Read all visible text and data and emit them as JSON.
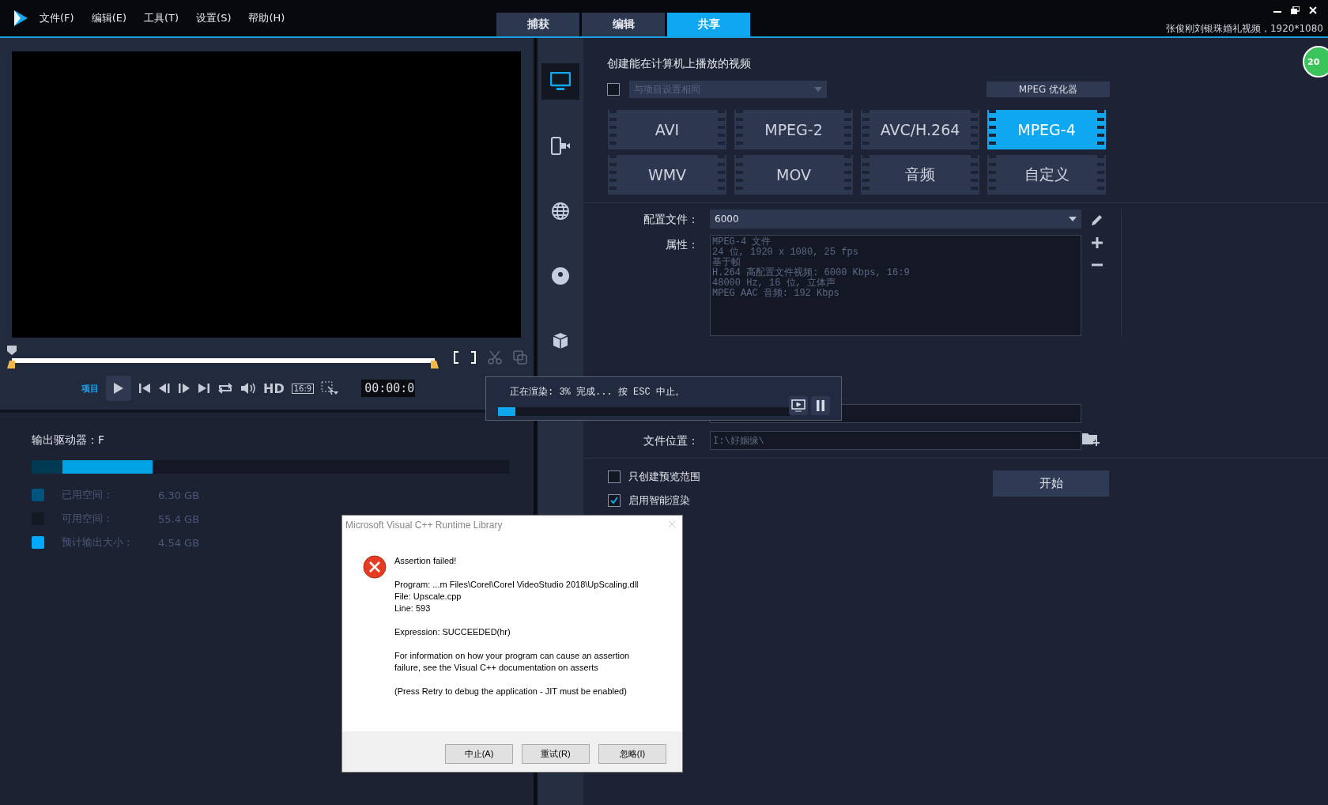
{
  "menu": [
    "文件(F)",
    "编辑(E)",
    "工具(T)",
    "设置(S)",
    "帮助(H)"
  ],
  "tabs": [
    {
      "label": "捕获",
      "selected": false
    },
    {
      "label": "编辑",
      "selected": false
    },
    {
      "label": "共享",
      "selected": true
    }
  ],
  "project_title": "张俊刚刘银珠婚礼视频，1920*1080",
  "player": {
    "mode_label": "项目",
    "hd": "HD",
    "aspect": "16:9",
    "timecode": "00:00:0"
  },
  "sidebar": [
    {
      "kind": "computer",
      "selected": true
    },
    {
      "kind": "device",
      "selected": false
    },
    {
      "kind": "web",
      "selected": false
    },
    {
      "kind": "disc",
      "selected": false
    },
    {
      "kind": "cube",
      "selected": false
    }
  ],
  "share": {
    "title": "创建能在计算机上播放的视频",
    "same_as_project": {
      "checked": false,
      "value": "与项目设置相同"
    },
    "optimizer_button": "MPEG 优化器",
    "formats": [
      {
        "label": "AVI",
        "selected": false
      },
      {
        "label": "MPEG-2",
        "selected": false
      },
      {
        "label": "AVC/H.264",
        "selected": false
      },
      {
        "label": "MPEG-4",
        "selected": true
      },
      {
        "label": "WMV",
        "selected": false
      },
      {
        "label": "MOV",
        "selected": false
      },
      {
        "label": "音频",
        "selected": false
      },
      {
        "label": "自定义",
        "selected": false
      }
    ],
    "profile": {
      "label": "配置文件：",
      "value": "6000"
    },
    "properties": {
      "label": "属性：",
      "lines": [
        "MPEG-4 文件",
        "24 位, 1920 x 1080, 25 fps",
        "基于帧",
        "H.264 高配置文件视频: 6000 Kbps, 16:9",
        "48000 Hz, 16 位, 立体声",
        "MPEG AAC 音频: 192 Kbps"
      ]
    },
    "file_location": {
      "label": "文件位置：",
      "value": "I:\\好姻缘\\"
    },
    "options": [
      {
        "label": "只创建预览范围",
        "checked": false
      },
      {
        "label": "启用智能渲染",
        "checked": true
      }
    ],
    "start_button": "开始"
  },
  "drive": {
    "label": "输出驱动器：F",
    "bar": [
      {
        "color": "#003a52",
        "level": 0.064
      },
      {
        "color": "#00a4e4",
        "level": 0.19
      }
    ],
    "legend": [
      {
        "label": "已用空间：",
        "value": "6.30 GB",
        "color": "#00537d"
      },
      {
        "label": "可用空间：",
        "value": "55.4 GB",
        "color": "#131824"
      },
      {
        "label": "预计输出大小：",
        "value": "4.54 GB",
        "color": "#00a8ff"
      }
    ]
  },
  "render_progress": {
    "status": "正在渲染:  3% 完成... 按 ESC 中止。",
    "level": 0.06
  },
  "dialog": {
    "title": "Microsoft Visual C++ Runtime Library",
    "heading": "Assertion failed!",
    "details": [
      "Program: ...m Files\\Corel\\Corel VideoStudio 2018\\UpScaling.dll",
      "File: Upscale.cpp",
      "Line: 593"
    ],
    "expression": "Expression: SUCCEEDED(hr)",
    "info": "For information on how your program can cause an assertion failure, see the Visual C++ documentation on asserts",
    "hint": "(Press Retry to debug the application - JIT must be enabled)",
    "buttons": [
      "中止(A)",
      "重试(R)",
      "忽略(I)"
    ]
  },
  "badge": "20"
}
